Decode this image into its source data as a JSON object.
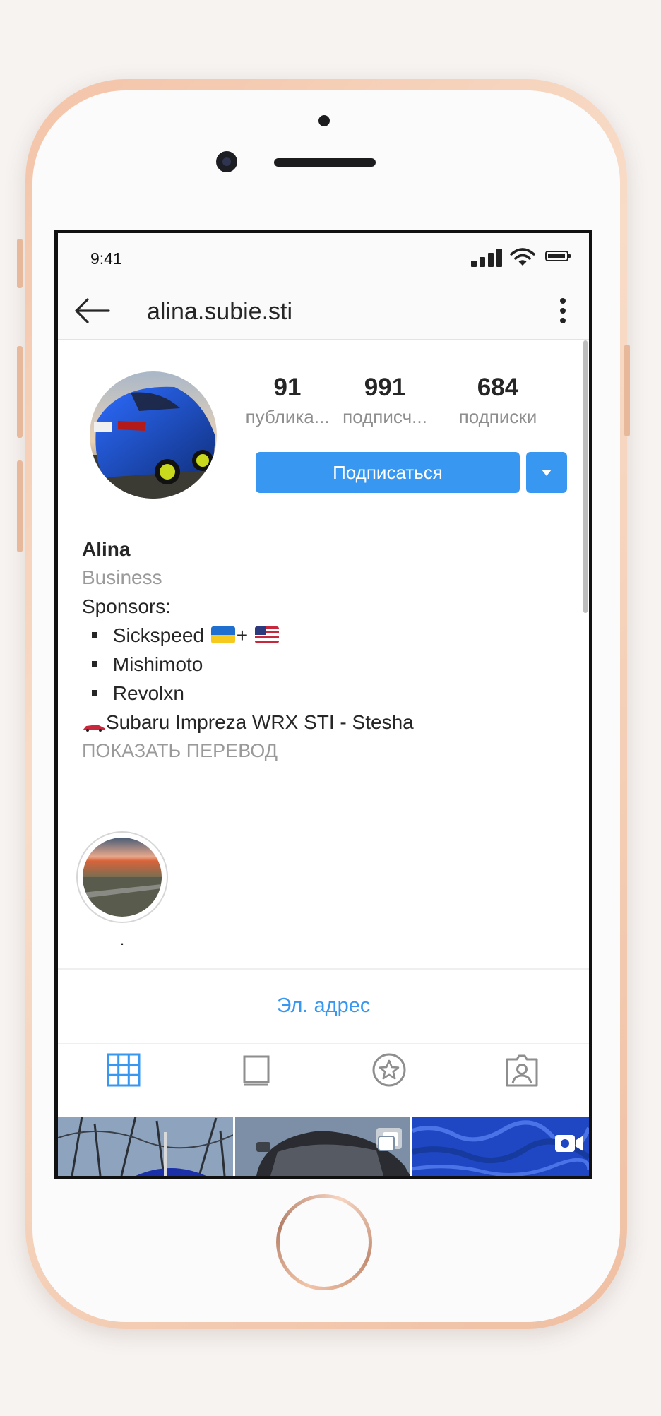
{
  "status_bar": {
    "time": "9:41"
  },
  "header": {
    "username": "alina.subie.sti"
  },
  "profile": {
    "stats": [
      {
        "value": "91",
        "label": "публика..."
      },
      {
        "value": "991",
        "label": "подписч..."
      },
      {
        "value": "684",
        "label": "подписки"
      }
    ],
    "follow_label": "Подписаться"
  },
  "bio": {
    "name": "Alina",
    "category": "Business",
    "sponsors_title": "Sponsors:",
    "sponsors": [
      "Sickspeed",
      "Mishimoto",
      "Revolxn"
    ],
    "sponsor_join": "+",
    "car": "Subaru Impreza WRX STI - Stesha",
    "translate": "ПОКАЗАТЬ ПЕРЕВОД"
  },
  "highlights": [
    {
      "label": "."
    }
  ],
  "contact": {
    "email_label": "Эл. адрес"
  },
  "tabs": [
    "grid-icon",
    "feed-icon",
    "saved-star-icon",
    "tagged-icon"
  ],
  "colors": {
    "accent": "#3897f0",
    "phone_frame": "#f3c4a8"
  }
}
